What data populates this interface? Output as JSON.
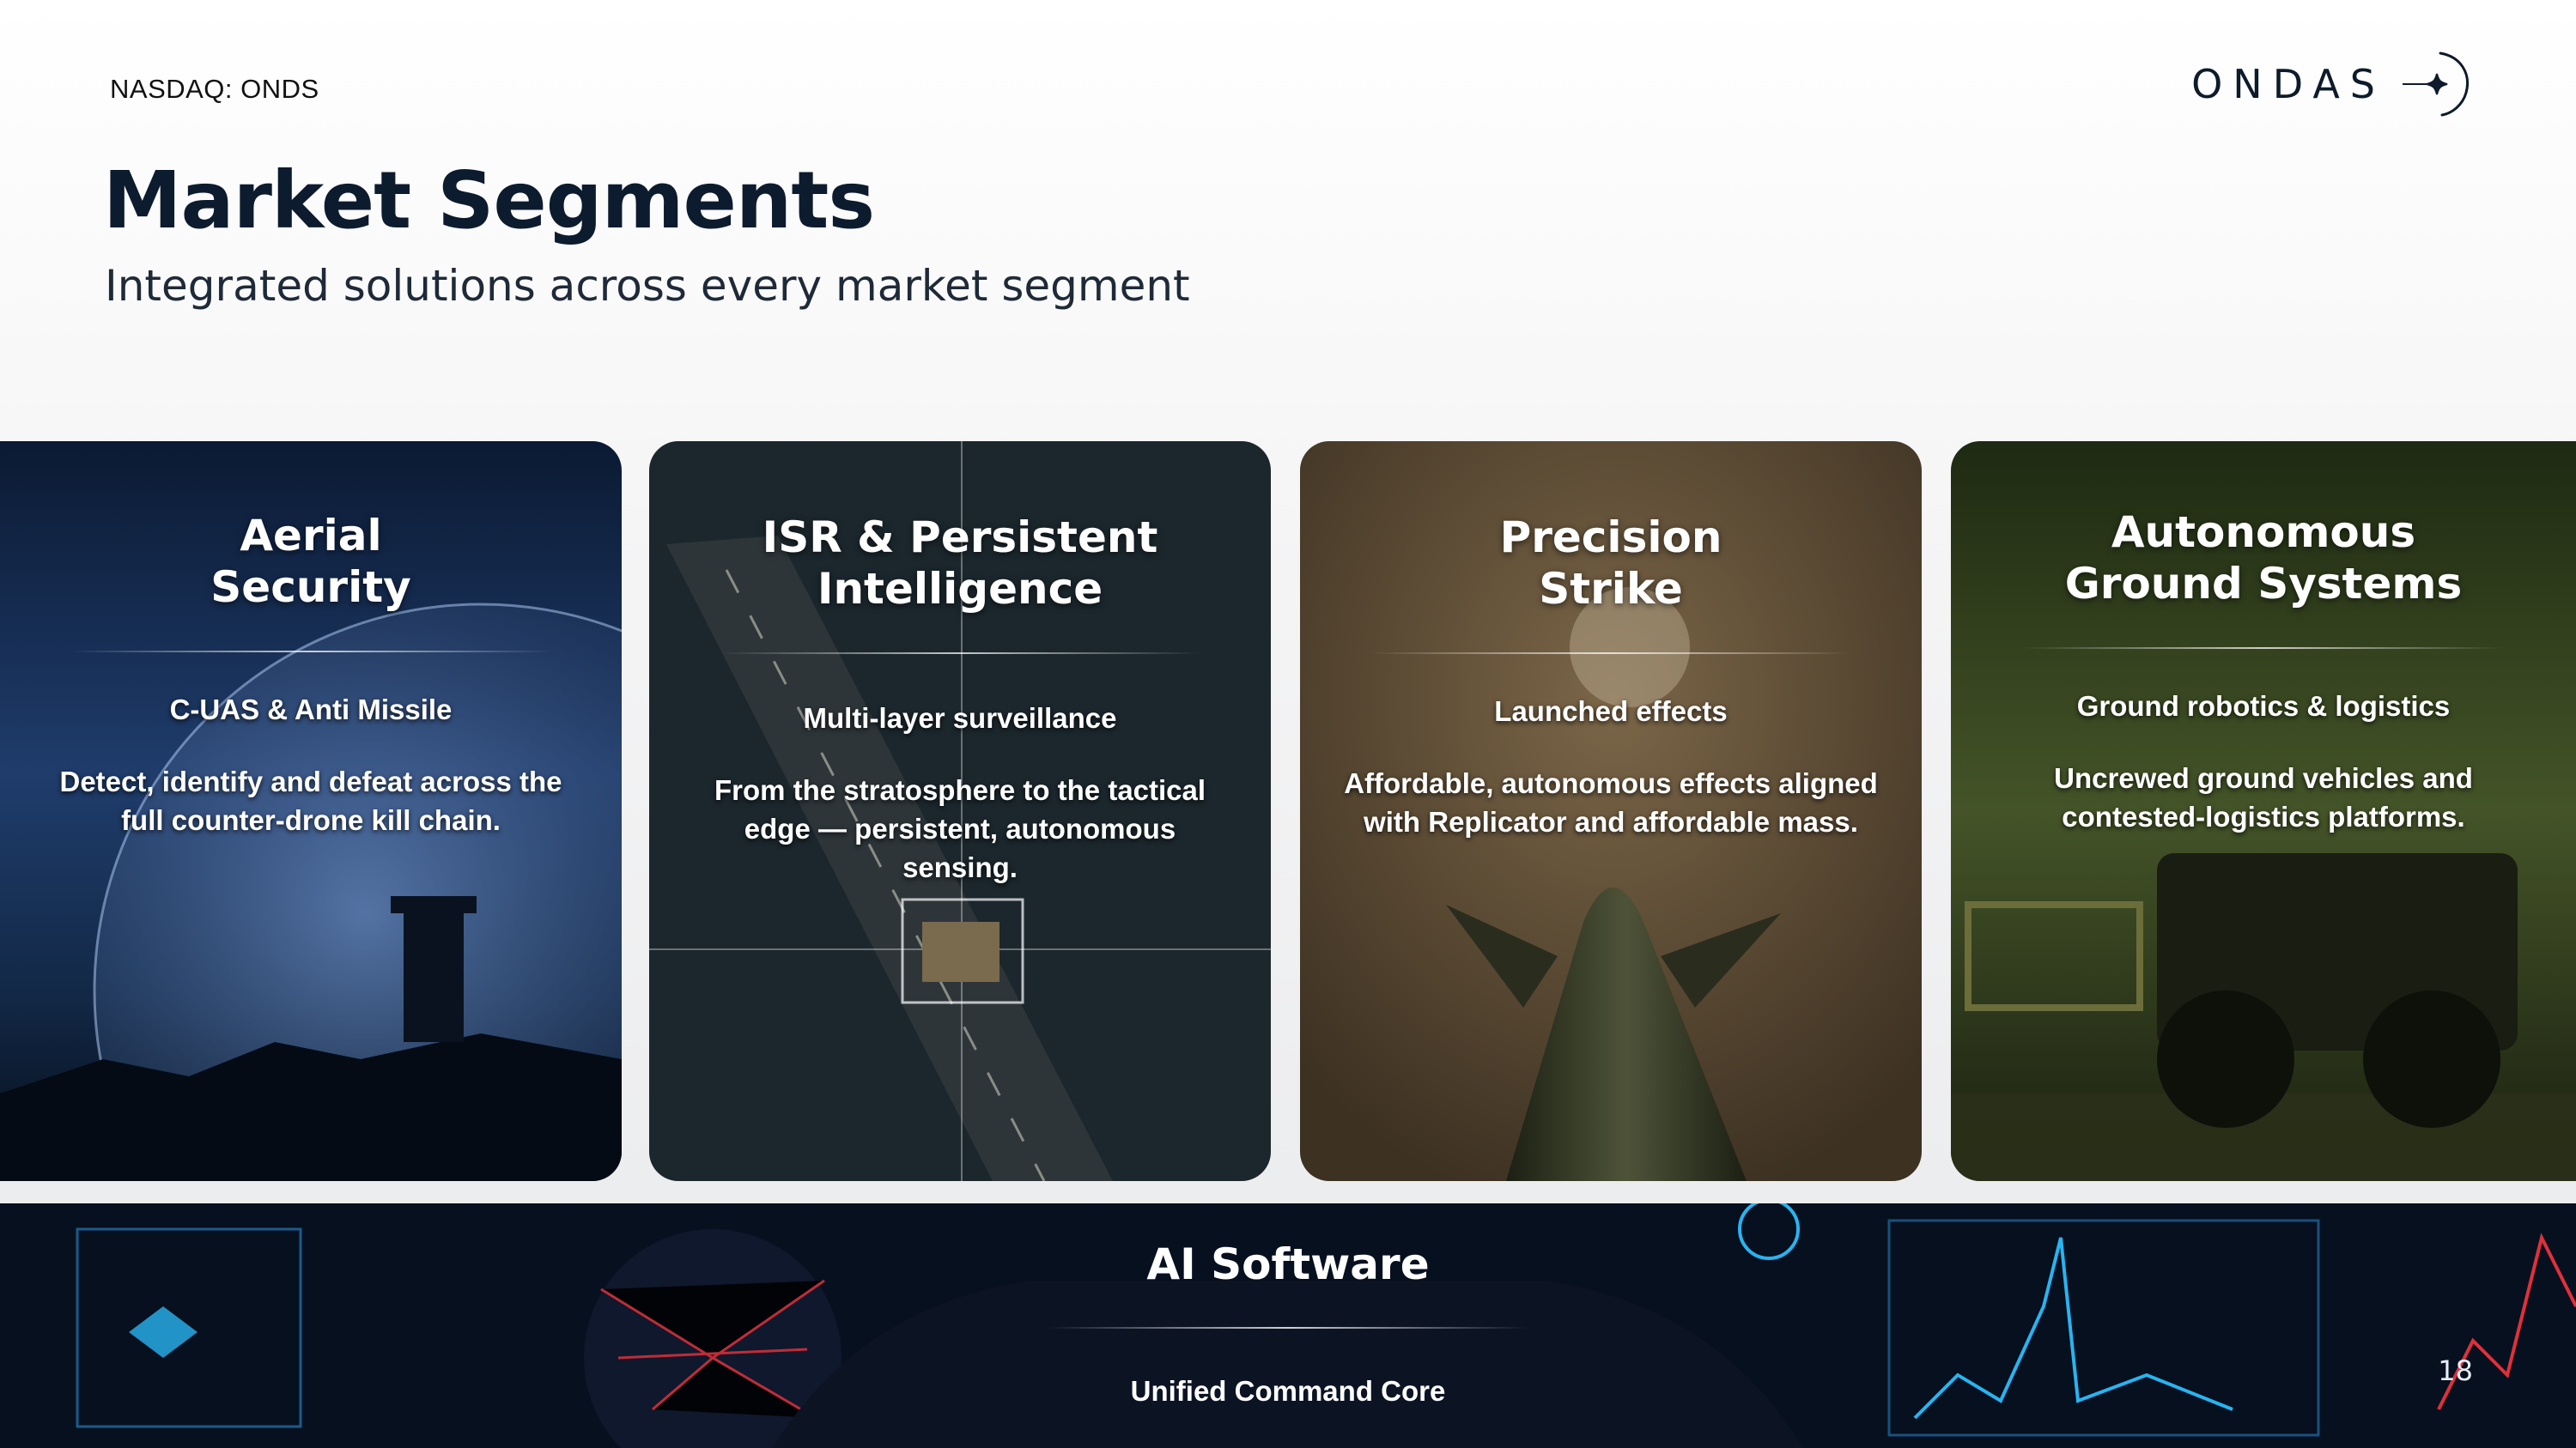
{
  "header": {
    "ticker": "NASDAQ: ONDS",
    "logo_text": "ONDAS",
    "title": "Market Segments",
    "subtitle": "Integrated solutions across every market segment"
  },
  "cards": [
    {
      "title_line1": "Aerial",
      "title_line2": "Security",
      "tagline": "C-UAS & Anti Missile",
      "description": "Detect, identify and defeat across the full counter-drone kill chain."
    },
    {
      "title_line1": "ISR & Persistent",
      "title_line2": "Intelligence",
      "tagline": "Multi-layer surveillance",
      "description": "From the stratosphere to the tactical edge — persistent, autonomous sensing."
    },
    {
      "title_line1": "Precision",
      "title_line2": "Strike",
      "tagline": "Launched effects",
      "description": "Affordable, autonomous effects aligned with Replicator and affordable mass."
    },
    {
      "title_line1": "Autonomous",
      "title_line2": "Ground Systems",
      "tagline": "Ground robotics & logistics",
      "description": "Uncrewed ground vehicles and contested-logistics platforms."
    }
  ],
  "bottom_panel": {
    "title": "AI Software",
    "tagline": "Unified Command Core"
  },
  "page_number": "18",
  "colors": {
    "title_navy": "#0d1b2e",
    "card_aerial": "#0f2440",
    "card_isr": "#1c2a30",
    "card_strike": "#5a4a36",
    "card_ground": "#2f3a1e",
    "software_bg": "#07101f",
    "accent_red": "#e0303a",
    "accent_cyan": "#28b4f0"
  }
}
